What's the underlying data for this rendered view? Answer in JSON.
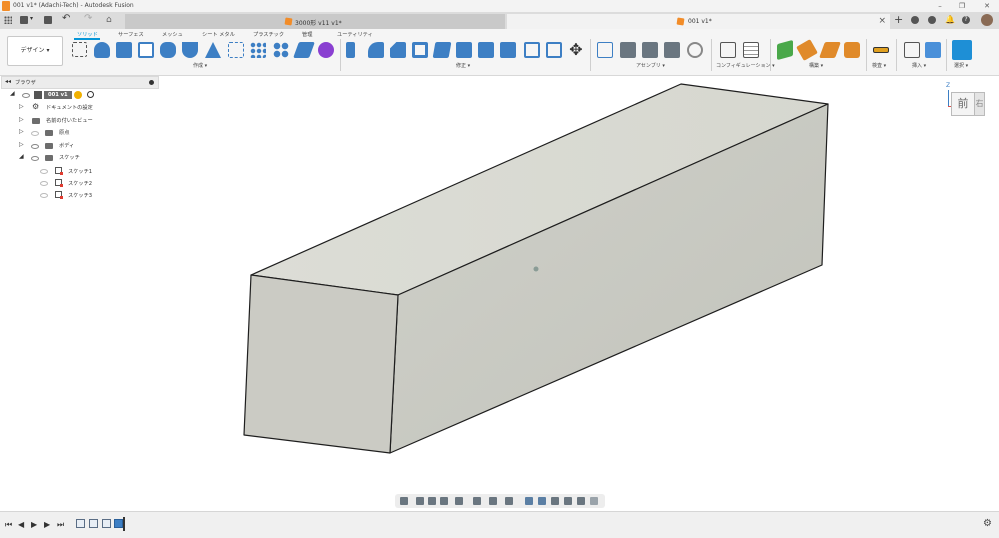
{
  "window": {
    "title": "001 v1* (Adachi-Tech) - Autodesk Fusion",
    "app_icon": "fusion-logo-icon",
    "controls": [
      "minimize-icon",
      "maximize-icon",
      "close-icon"
    ]
  },
  "tabs": [
    {
      "label": "3000形 v11 v1*",
      "active": false,
      "icon": "component-cube-icon"
    },
    {
      "label": "001 v1*",
      "active": true,
      "icon": "component-cube-icon"
    }
  ],
  "toolbar": {
    "design_label": "デザイン ▾",
    "ribbon_tabs": [
      {
        "label": "ソリッド",
        "active": true
      },
      {
        "label": "サーフェス",
        "active": false
      },
      {
        "label": "メッシュ",
        "active": false
      },
      {
        "label": "シート メタル",
        "active": false
      },
      {
        "label": "プラスチック",
        "active": false
      },
      {
        "label": "管理",
        "active": false
      },
      {
        "label": "ユーティリティ",
        "active": false
      }
    ],
    "groups": [
      {
        "label": "作成 ▾"
      },
      {
        "label": "修正 ▾"
      },
      {
        "label": "アセンブリ ▾"
      },
      {
        "label": "コンフィギュレーション ▾"
      },
      {
        "label": "構築 ▾"
      },
      {
        "label": "検査 ▾"
      },
      {
        "label": "挿入 ▾"
      },
      {
        "label": "選択 ▾"
      }
    ],
    "accent": "#0696d7"
  },
  "browser": {
    "title": "ブラウザ",
    "root": "001 v1",
    "items": [
      {
        "label": "ドキュメントの設定"
      },
      {
        "label": "名前の付いたビュー"
      },
      {
        "label": "原点"
      },
      {
        "label": "ボディ"
      },
      {
        "label": "スケッチ"
      }
    ],
    "sketches": [
      {
        "label": "スケッチ1"
      },
      {
        "label": "スケッチ2"
      },
      {
        "label": "スケッチ3"
      }
    ]
  },
  "viewcube": {
    "face_label": "前",
    "side_label": "右",
    "z_label": "Z"
  },
  "viewport": {
    "body_color": "#c9cbc4",
    "edge_color": "#1e1e1e"
  }
}
